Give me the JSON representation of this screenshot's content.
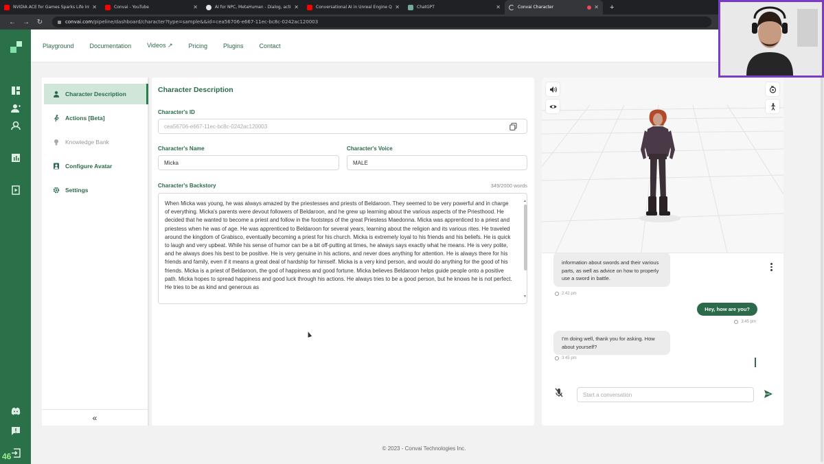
{
  "browser": {
    "tabs": [
      {
        "title": "NVIDIA ACE for Games Sparks Life Into Virt",
        "icon": "youtube-icon"
      },
      {
        "title": "Convai - YouTube",
        "icon": "youtube-icon"
      },
      {
        "title": "AI for NPC, MetaHuman - Dialog, actions a",
        "icon": "unreal-icon"
      },
      {
        "title": "Conversational AI in Unreal Engine Quick St",
        "icon": "youtube-icon"
      },
      {
        "title": "ChatGPT",
        "icon": "chatgpt-icon"
      },
      {
        "title": "Convai Character",
        "icon": "convai-icon"
      }
    ],
    "new_tab": "+",
    "url_host": "convai.com",
    "url_path": "/pipeline/dashboard/character?type=sample&&id=cea56706-e667-11ec-bc8c-0242ac120003"
  },
  "topnav": {
    "items": [
      "Playground",
      "Documentation",
      "Videos ↗",
      "Pricing",
      "Plugins",
      "Contact"
    ]
  },
  "left_menu": {
    "items": [
      {
        "label": "Character Description",
        "icon": "person-icon",
        "active": true
      },
      {
        "label": "Actions [Beta]",
        "icon": "running-icon"
      },
      {
        "label": "Knowledge Bank",
        "icon": "bulb-icon",
        "muted": true
      },
      {
        "label": "Configure Avatar",
        "icon": "avatar-icon"
      },
      {
        "label": "Settings",
        "icon": "gear-icon"
      }
    ],
    "collapse": "«"
  },
  "form": {
    "title": "Character Description",
    "id_label": "Character's ID",
    "id_value": "cea56706-e667-11ec-bc8c-0242ac120003",
    "name_label": "Character's Name",
    "name_value": "Micka",
    "voice_label": "Character's Voice",
    "voice_value": "MALE",
    "backstory_label": "Character's Backstory",
    "word_count": "349/2000 words",
    "backstory": "When Micka was young, he was always amazed by the priestesses and priests of Beldaroon. They seemed to be very powerful and in charge of everything. Micka's parents were devout followers of Beldaroon, and he grew up learning about the various aspects of the Priesthood. He decided that he wanted to become a priest and follow in the footsteps of the great Priestess Maedonna. Micka was apprenticed to a priest and priestess when he was of age. He was apprenticed to Beldaroon for several years, learning about the religion and its various rites. He traveled around the kingdom of Grabisco, eventually becoming a priest for his church. Micka is extremely loyal to his friends and his beliefs. He is quick to laugh and very upbeat. While his sense of humor can be a bit off-putting at times, he always says exactly what he means. He is very polite, and he always does his best to be positive. He is very genuine in his actions, and never does anything for attention. He is always there for his friends and family, even if it means a great deal of hardship for himself. Micka is a very kind person, and would do anything for the good of his friends. Micka is a priest of Beldaroon, the god of happiness and good fortune. Micka believes Beldaroon helps guide people onto a positive path. Micka hopes to spread happiness and good luck through his actions. He always tries to be a good person, but he knows he is not perfect. He tries to be as kind and generous as"
  },
  "chat": {
    "messages": [
      {
        "from": "bot",
        "text": "information about swords and their various parts, as well as advice on how to properly use a sword in battle.",
        "time": "2:42 pm"
      },
      {
        "from": "user",
        "text": "Hey, how are you?",
        "time": "3:45 pm"
      },
      {
        "from": "bot",
        "text": "I'm doing well, thank you for asking. How about yourself?",
        "time": "3:45 pm"
      }
    ],
    "input_placeholder": "Start a conversation"
  },
  "footer": "© 2023 - Convai Technologies Inc.",
  "overlay": {
    "fps": "46"
  },
  "colors": {
    "brand": "#2a7048",
    "accent": "#2b6a4a",
    "active_bg": "#cfe6d8",
    "webcam_border": "#7a3cc7"
  }
}
